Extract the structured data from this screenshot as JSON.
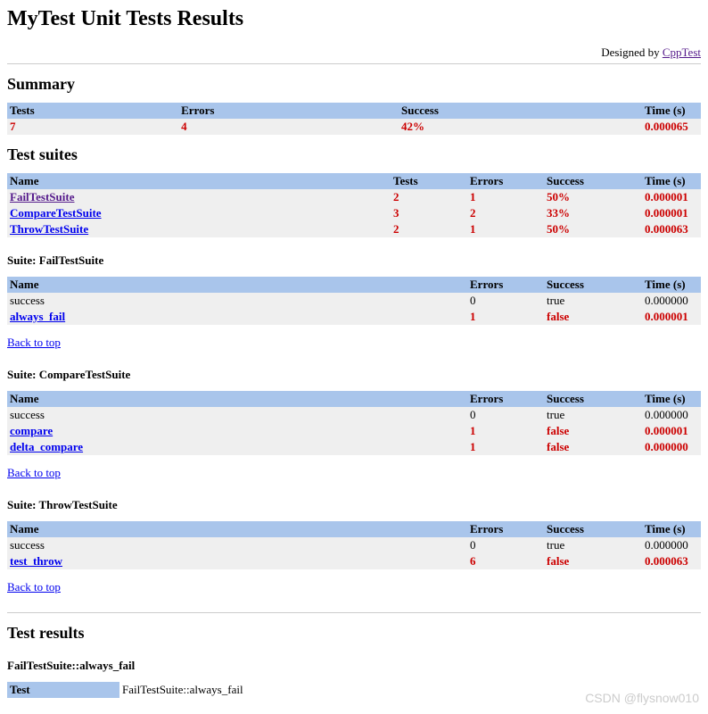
{
  "title": "MyTest Unit Tests Results",
  "designed_by_label": "Designed by ",
  "designed_by_link": "CppTest",
  "summary": {
    "title": "Summary",
    "headers": {
      "tests": "Tests",
      "errors": "Errors",
      "success": "Success",
      "time": "Time (s)"
    },
    "row": {
      "tests": "7",
      "errors": "4",
      "success": "42%",
      "time": "0.000065"
    }
  },
  "suites_overview": {
    "title": "Test suites",
    "headers": {
      "name": "Name",
      "tests": "Tests",
      "errors": "Errors",
      "success": "Success",
      "time": "Time (s)"
    },
    "rows": [
      {
        "name": "FailTestSuite",
        "tests": "2",
        "errors": "1",
        "success": "50%",
        "time": "0.000001",
        "visited": true
      },
      {
        "name": "CompareTestSuite",
        "tests": "3",
        "errors": "2",
        "success": "33%",
        "time": "0.000001",
        "visited": false
      },
      {
        "name": "ThrowTestSuite",
        "tests": "2",
        "errors": "1",
        "success": "50%",
        "time": "0.000063",
        "visited": false
      }
    ]
  },
  "suite_details": [
    {
      "title": "Suite: FailTestSuite",
      "headers": {
        "name": "Name",
        "errors": "Errors",
        "success": "Success",
        "time": "Time (s)"
      },
      "rows": [
        {
          "name": "success",
          "link": false,
          "errors": "0",
          "success": "true",
          "time": "0.000000",
          "fail": false
        },
        {
          "name": "always_fail",
          "link": true,
          "errors": "1",
          "success": "false",
          "time": "0.000001",
          "fail": true
        }
      ]
    },
    {
      "title": "Suite: CompareTestSuite",
      "headers": {
        "name": "Name",
        "errors": "Errors",
        "success": "Success",
        "time": "Time (s)"
      },
      "rows": [
        {
          "name": "success",
          "link": false,
          "errors": "0",
          "success": "true",
          "time": "0.000000",
          "fail": false
        },
        {
          "name": "compare",
          "link": true,
          "errors": "1",
          "success": "false",
          "time": "0.000001",
          "fail": true
        },
        {
          "name": "delta_compare",
          "link": true,
          "errors": "1",
          "success": "false",
          "time": "0.000000",
          "fail": true
        }
      ]
    },
    {
      "title": "Suite: ThrowTestSuite",
      "headers": {
        "name": "Name",
        "errors": "Errors",
        "success": "Success",
        "time": "Time (s)"
      },
      "rows": [
        {
          "name": "success",
          "link": false,
          "errors": "0",
          "success": "true",
          "time": "0.000000",
          "fail": false
        },
        {
          "name": "test_throw",
          "link": true,
          "errors": "6",
          "success": "false",
          "time": "0.000063",
          "fail": true
        }
      ]
    }
  ],
  "back_to_top": "Back to top",
  "test_results": {
    "title": "Test results",
    "detail_title": "FailTestSuite::always_fail",
    "partial_header": "Test",
    "partial_value": "FailTestSuite::always_fail"
  },
  "watermark": "CSDN @flysnow010"
}
